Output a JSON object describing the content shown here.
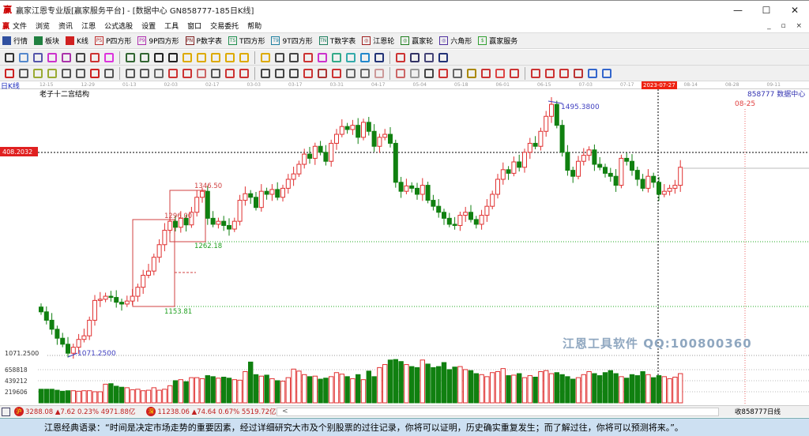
{
  "window": {
    "title": "赢家江恩专业版[赢家服务平台] - [数据中心  GN858777-185日K线]",
    "minimize": "—",
    "maximize": "☐",
    "close": "✕"
  },
  "menu": [
    "文件",
    "浏览",
    "资讯",
    "江恩",
    "公式选股",
    "设置",
    "工具",
    "窗口",
    "交易委托",
    "帮助"
  ],
  "mdi_controls": "_ ▫ ×",
  "toolbar": [
    {
      "label": "行情",
      "icon": "grid-icon",
      "color": "#3050a0"
    },
    {
      "label": "板块",
      "icon": "blocks-icon",
      "color": "#208040"
    },
    {
      "label": "K线",
      "icon": "kline-icon",
      "color": "#d02020"
    },
    {
      "label": "P四方形",
      "icon": "p4-icon",
      "color": "#c03030",
      "tag": "PS"
    },
    {
      "label": "9P四方形",
      "icon": "9p4-icon",
      "color": "#b030b0",
      "tag": "P9"
    },
    {
      "label": "P数字表",
      "icon": "pnum-icon",
      "color": "#802020",
      "tag": "PN"
    },
    {
      "label": "T四方形",
      "icon": "t4-icon",
      "color": "#209050",
      "tag": "TS"
    },
    {
      "label": "9T四方形",
      "icon": "9t4-icon",
      "color": "#2080a0",
      "tag": "T9"
    },
    {
      "label": "T数字表",
      "icon": "tnum-icon",
      "color": "#208060",
      "tag": "TN"
    },
    {
      "label": "江恩轮",
      "icon": "wheel-icon",
      "color": "#a02020",
      "tag": "◎"
    },
    {
      "label": "赢家轮",
      "icon": "win-wheel-icon",
      "color": "#208020",
      "tag": "◎"
    },
    {
      "label": "六角形",
      "icon": "hexagon-icon",
      "color": "#5030a0",
      "tag": "◎"
    },
    {
      "label": "赢家服务",
      "icon": "dollar-icon",
      "color": "#30a030",
      "tag": "$"
    }
  ],
  "axis": {
    "label": "日K线",
    "dates": [
      "12-15",
      "12-29",
      "01-13",
      "02-03",
      "02-17",
      "03-03",
      "03-17",
      "03-31",
      "04-17",
      "05-04",
      "05-18",
      "06-01",
      "06-15",
      "07-03",
      "07-17",
      "08-14",
      "08-28",
      "09-11"
    ],
    "cursor_date": "2023-07-27"
  },
  "chart": {
    "title": "老子十二宫结构",
    "code_label": "858777  数据中心",
    "price_cursor": "408.2032",
    "future_date": "08-25",
    "high_label": "1495.3800",
    "low_label": "1071.2500",
    "low_axis_label": "1071.2500",
    "levels": [
      "1346.50",
      "1296.00",
      "1262.18",
      "1153.81"
    ],
    "volume_ticks": [
      "658818",
      "439212",
      "219606"
    ],
    "closes": [
      1144,
      1130,
      1115,
      1100,
      1090,
      1075,
      1085,
      1098,
      1104,
      1130,
      1163,
      1165,
      1170,
      1168,
      1160,
      1157,
      1162,
      1170,
      1185,
      1205,
      1212,
      1235,
      1256,
      1280,
      1295,
      1285,
      1300,
      1289,
      1310,
      1335,
      1345,
      1300,
      1290,
      1295,
      1288,
      1282,
      1295,
      1330,
      1341,
      1335,
      1318,
      1345,
      1340,
      1348,
      1335,
      1350,
      1365,
      1374,
      1390,
      1407,
      1400,
      1420,
      1410,
      1395,
      1425,
      1440,
      1453,
      1448,
      1455,
      1435,
      1460,
      1445,
      1420,
      1435,
      1440,
      1425,
      1360,
      1345,
      1354,
      1350,
      1340,
      1355,
      1330,
      1320,
      1310,
      1300,
      1290,
      1288,
      1305,
      1310,
      1298,
      1290,
      1305,
      1320,
      1340,
      1365,
      1381,
      1375,
      1394,
      1385,
      1410,
      1425,
      1420,
      1445,
      1470,
      1490,
      1455,
      1410,
      1380,
      1370,
      1395,
      1405,
      1414,
      1390,
      1385,
      1375,
      1370,
      1355,
      1400,
      1395,
      1380,
      1365,
      1350,
      1370,
      1360,
      1340,
      1345,
      1350,
      1355,
      1385
    ],
    "volumes": [
      270,
      270,
      270,
      250,
      230,
      240,
      240,
      230,
      240,
      240,
      220,
      220,
      370,
      380,
      330,
      310,
      300,
      260,
      270,
      240,
      250,
      300,
      250,
      270,
      340,
      440,
      460,
      420,
      500,
      500,
      480,
      540,
      520,
      490,
      510,
      490,
      460,
      450,
      620,
      810,
      560,
      530,
      550,
      480,
      440,
      430,
      500,
      670,
      630,
      560,
      520,
      530,
      470,
      490,
      520,
      600,
      570,
      520,
      480,
      560,
      460,
      630,
      520,
      700,
      760,
      850,
      860,
      820,
      760,
      720,
      700,
      850,
      770,
      700,
      720,
      800,
      660,
      710,
      720,
      660,
      640,
      580,
      560,
      520,
      600,
      620,
      680,
      540,
      550,
      580,
      500,
      540,
      510,
      620,
      640,
      580,
      600,
      560,
      520,
      470,
      500,
      560,
      620,
      580,
      540,
      600,
      640,
      580,
      520,
      490,
      560,
      540,
      620,
      560,
      500,
      540,
      520,
      480,
      510,
      580
    ],
    "watermark": "江恩工具软件  QQ:100800360",
    "colors": {
      "up": "#e03030",
      "down": "#108010",
      "level_red": "#d04040",
      "level_green": "#20a020",
      "label_blue": "#4040c0"
    }
  },
  "status": {
    "sh_badge": "沪",
    "sh_text": "3288.08 ▲7.62 0.23% 4971.88亿",
    "sz_badge": "深",
    "sz_text": "11238.06 ▲74.64 0.67% 5519.72亿",
    "scroll_left": "<",
    "right_text": "收858777日线"
  },
  "quote": "江恩经典语录：“时间是决定市场走势的重要因素，经过详细研究大市及个别股票的过往记录，你将可以证明，历史确实重复发生；而了解过往，你将可以预测将来。”。"
}
